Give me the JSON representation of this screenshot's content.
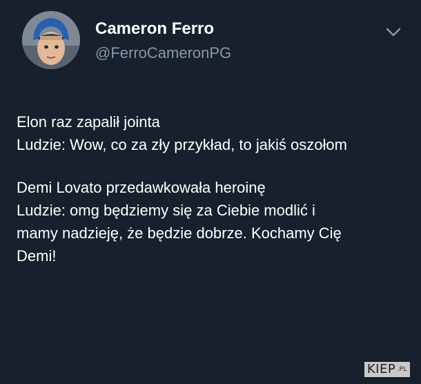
{
  "tweet": {
    "author": {
      "display_name": "Cameron Ferro",
      "handle": "@FerroCameronPG",
      "avatar_icon": "user-avatar-photo"
    },
    "menu_icon": "chevron-down-icon",
    "paragraphs": [
      {
        "lines": [
          "Elon raz zapalił jointa",
          "Ludzie: Wow, co za zły przykład, to jakiś oszołom"
        ]
      },
      {
        "lines": [
          "Demi Lovato przedawkowała heroinę",
          "Ludzie: omg będziemy się za Ciebie modlić i",
          "mamy nadzieję, że będzie dobrze. Kochamy Cię",
          "Demi!"
        ]
      }
    ]
  },
  "watermark": {
    "brand": "KIEP",
    "suffix": ".PL"
  },
  "colors": {
    "background": "#18202d",
    "text": "#ffffff",
    "secondary_text": "#8899a6"
  }
}
